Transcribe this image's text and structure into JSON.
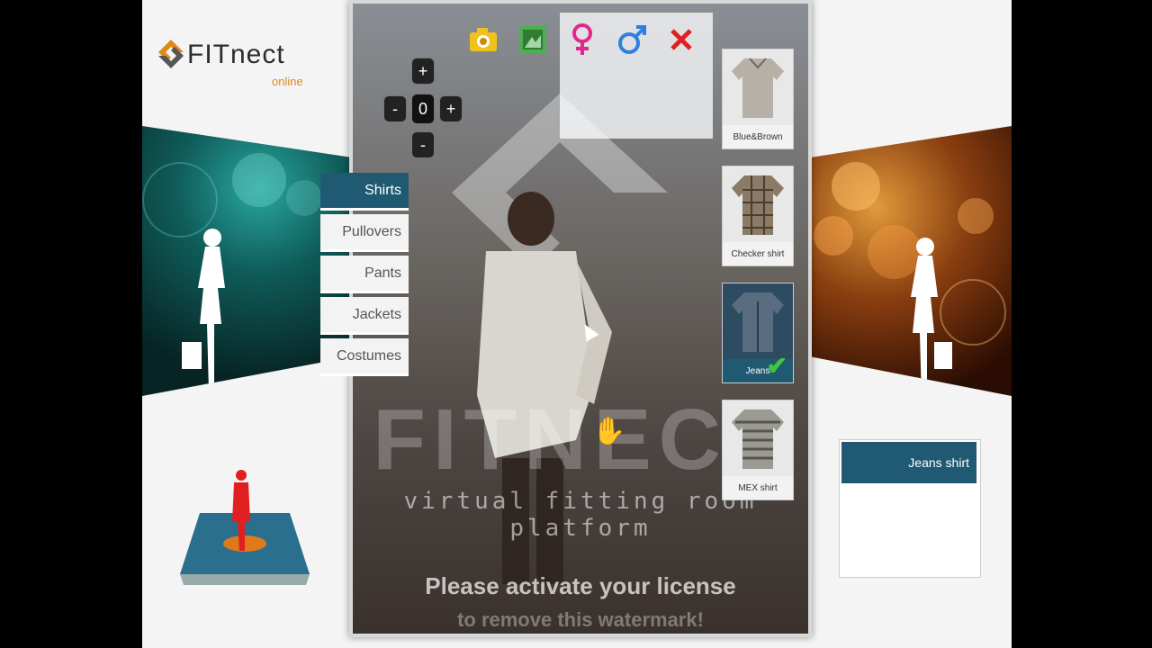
{
  "app": {
    "brand": "FITnect",
    "sub": "online"
  },
  "toolbar": {
    "buttons": [
      {
        "name": "camera",
        "icon": "camera-icon",
        "glyph": "📷"
      },
      {
        "name": "photo",
        "icon": "photo-icon",
        "glyph": "▣"
      },
      {
        "name": "female",
        "icon": "female-icon",
        "glyph": "♀"
      },
      {
        "name": "male",
        "icon": "male-icon",
        "glyph": "♂"
      },
      {
        "name": "close",
        "icon": "close-icon",
        "glyph": "✖"
      }
    ]
  },
  "zoom": {
    "plus_top": "+",
    "minus_left": "-",
    "value": "0",
    "plus_right": "+",
    "minus_bottom": "-"
  },
  "categories": [
    "Shirts",
    "Pullovers",
    "Pants",
    "Jackets",
    "Costumes"
  ],
  "active_category": "Shirts",
  "items": [
    {
      "label": "Blue&Brown",
      "selected": false
    },
    {
      "label": "Checker shirt",
      "selected": false
    },
    {
      "label": "Jeans",
      "selected": true
    },
    {
      "label": "MEX shirt",
      "selected": false
    }
  ],
  "selected_panel": {
    "title": "Jeans shirt"
  },
  "watermark": {
    "big": "FITNECT",
    "platform": "virtual fitting room platform",
    "license_line1": "Please activate your license",
    "license_line2": "to remove this watermark!"
  },
  "colors": {
    "accent": "#1f5a72",
    "check": "#43c43e",
    "logo_orange": "#e0891a"
  }
}
